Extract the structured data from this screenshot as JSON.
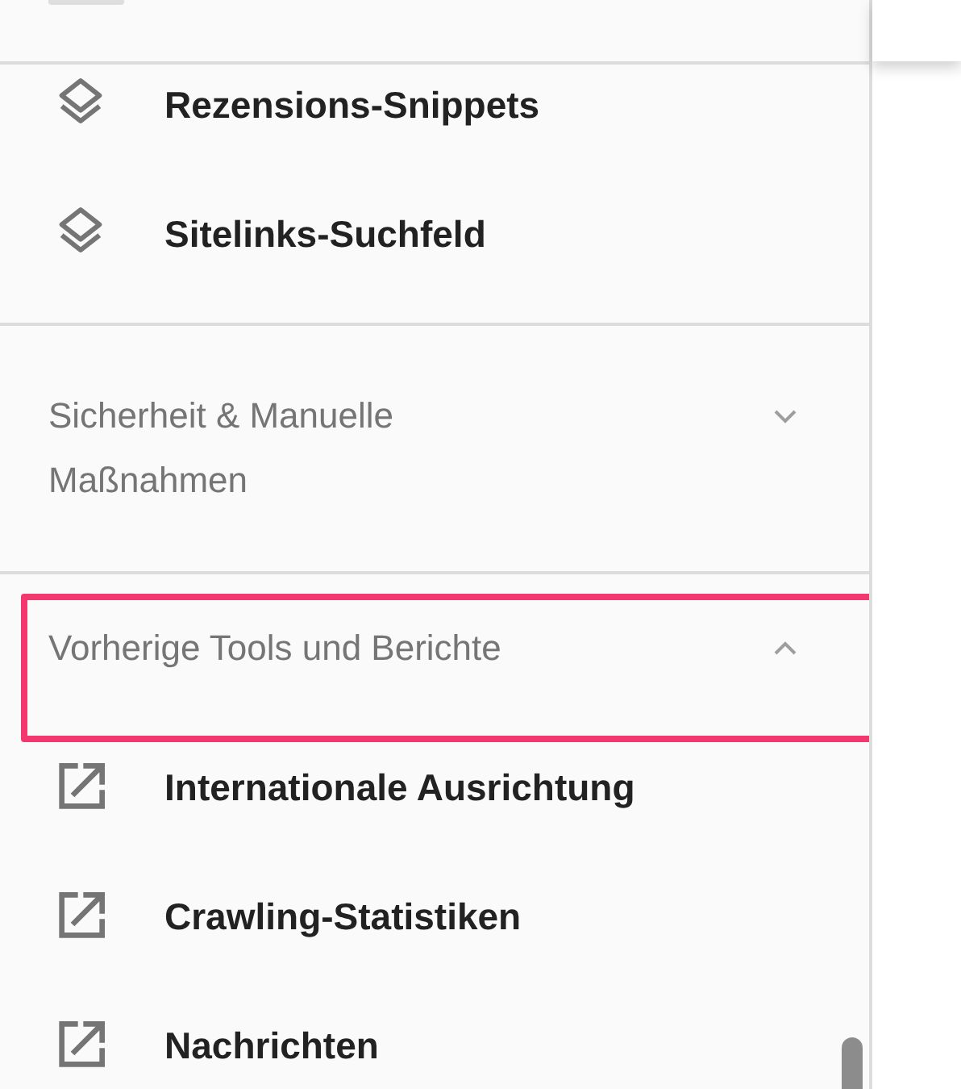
{
  "nav": [
    {
      "kind": "list",
      "items": [
        {
          "label": "Rezensions-Snippets",
          "kind": "enhancement"
        },
        {
          "label": "Sitelinks-Suchfeld",
          "kind": "enhancement"
        }
      ]
    },
    {
      "kind": "section",
      "title": "Sicherheit & Manuelle Maßnahmen",
      "expanded": false,
      "highlighted": false
    },
    {
      "kind": "section",
      "title": "Vorherige Tools und Berichte",
      "expanded": true,
      "highlighted": true,
      "items": [
        {
          "label": "Internationale Ausrichtung",
          "kind": "external"
        },
        {
          "label": "Crawling-Statistiken",
          "kind": "external"
        },
        {
          "label": "Nachrichten",
          "kind": "external"
        }
      ]
    }
  ]
}
